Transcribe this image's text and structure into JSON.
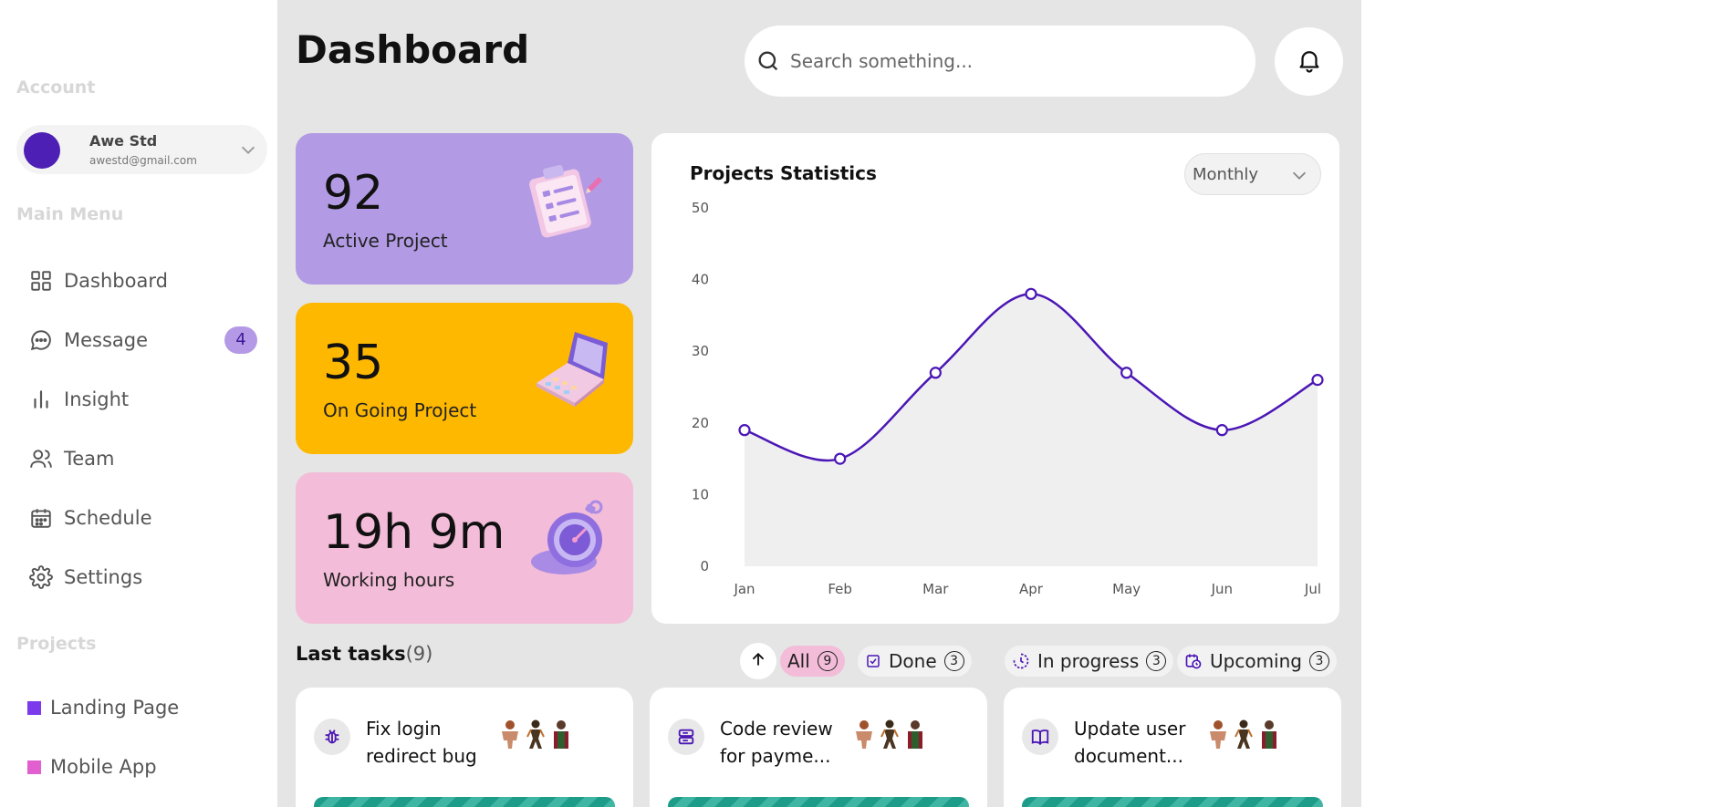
{
  "sidebar": {
    "account_label": "Account",
    "user": {
      "name": "Awe Std",
      "email": "awestd@gmail.com"
    },
    "main_menu_label": "Main Menu",
    "items": [
      {
        "label": "Dashboard",
        "icon": "grid-icon"
      },
      {
        "label": "Message",
        "icon": "chat-icon",
        "badge": "4"
      },
      {
        "label": "Insight",
        "icon": "bar-chart-icon"
      },
      {
        "label": "Team",
        "icon": "users-icon"
      },
      {
        "label": "Schedule",
        "icon": "calendar-icon"
      },
      {
        "label": "Settings",
        "icon": "gear-icon"
      }
    ],
    "projects_label": "Projects",
    "projects": [
      {
        "label": "Landing Page",
        "color": "#7c3aed"
      },
      {
        "label": "Mobile App",
        "color": "#e25fcf"
      }
    ]
  },
  "header": {
    "title": "Dashboard",
    "search_placeholder": "Search something..."
  },
  "stats": [
    {
      "value": "92",
      "label": "Active Project",
      "color": "#b29be4",
      "icon": "clipboard-icon"
    },
    {
      "value": "35",
      "label": "On Going Project",
      "color": "#ffb800",
      "icon": "laptop-icon"
    },
    {
      "value": "19h 9m",
      "label": "Working hours",
      "color": "#f3bcd8",
      "icon": "stopwatch-icon"
    }
  ],
  "statistics": {
    "title": "Projects Statistics",
    "period": "Monthly"
  },
  "chart_data": {
    "type": "area",
    "title": "Projects Statistics",
    "categories": [
      "Jan",
      "Feb",
      "Mar",
      "Apr",
      "May",
      "Jun",
      "Jul"
    ],
    "values": [
      19,
      15,
      27,
      38,
      27,
      19,
      26
    ],
    "ylim": [
      0,
      50
    ],
    "yticks": [
      0,
      10,
      20,
      30,
      40,
      50
    ],
    "xlabel": "",
    "ylabel": "",
    "grid": false,
    "line_color": "#4b16b5",
    "fill_color": "#efefef"
  },
  "tasks": {
    "title": "Last tasks",
    "count": "(9)",
    "filters": [
      {
        "label": "All",
        "count": "9",
        "active": true
      },
      {
        "label": "Done",
        "count": "3",
        "icon": "check-square-icon"
      },
      {
        "label": "In progress",
        "count": "3",
        "icon": "clock-progress-icon"
      },
      {
        "label": "Upcoming",
        "count": "3",
        "icon": "calendar-clock-icon"
      }
    ],
    "items": [
      {
        "title": "Fix login redirect bug",
        "icon": "bug-icon"
      },
      {
        "title": "Code review for payme...",
        "icon": "server-icon"
      },
      {
        "title": "Update user document...",
        "icon": "book-icon"
      }
    ]
  }
}
